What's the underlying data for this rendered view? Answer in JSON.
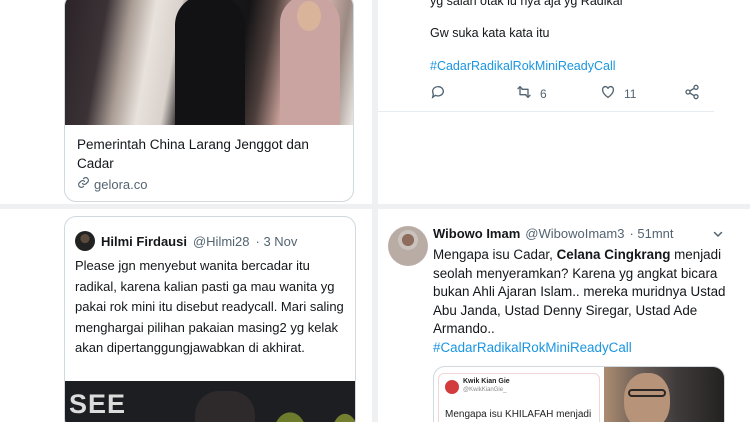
{
  "left_top": {
    "link_card": {
      "title": "Pemerintah China Larang Jenggot dan Cadar",
      "domain": "gelora.co"
    }
  },
  "right_top": {
    "line1": "yg salah otak lu nya aja yg Radikal",
    "line2": "Gw suka kata kata itu",
    "hashtag": "#CadarRadikalRokMiniReadyCall",
    "retweets": "6",
    "likes": "11"
  },
  "left_bottom": {
    "quoted_tweet": {
      "name": "Hilmi Firdausi",
      "handle": "@Hilmi28",
      "date": "· 3 Nov",
      "body": "Please jgn menyebut wanita bercadar itu radikal, karena kalian pasti ga mau wanita yg pakai rok mini itu disebut readycall. Mari saling menghargai pilihan pakaian masing2 yg kelak akan dipertanggungjawabkan di akhirat.",
      "image_text": "SEE"
    }
  },
  "right_bottom": {
    "tweet": {
      "name": "Wibowo Imam",
      "handle": "@WibowoImam3",
      "time": "· 51mnt",
      "body_pre": "Mengapa isu Cadar, ",
      "body_bold": "Celana Cingkrang",
      "body_rest": " menjadi seolah menyeramkan? Karena yg angkat bicara bukan Ahli Ajaran Islam.. mereka muridnya Ustad Abu Janda, Ustad Denny Siregar, Ustad Ade Armando..",
      "hashtag": "#CadarRadikalRokMiniReadyCall",
      "embedded_card": {
        "name": "Kwik Kian Gie",
        "handle": "@KwikKianGie_",
        "text": "Mengapa isu KHILAFAH menjadi seolah"
      }
    }
  },
  "colors": {
    "link": "#1b95e0",
    "muted": "#536471",
    "border": "#cfd9de"
  },
  "icons": [
    "link-icon",
    "reply-icon",
    "retweet-icon",
    "like-icon",
    "share-icon",
    "chevron-down-icon"
  ]
}
